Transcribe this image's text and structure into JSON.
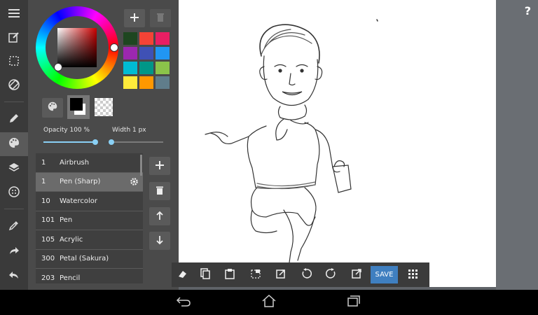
{
  "toolbar": {
    "items": [
      {
        "icon": "menu-icon"
      },
      {
        "icon": "new-canvas-icon"
      },
      {
        "icon": "selection-icon"
      },
      {
        "icon": "transform-icon"
      },
      {
        "icon": "pen-icon"
      },
      {
        "icon": "palette-icon",
        "active": true
      },
      {
        "icon": "layers-icon"
      },
      {
        "icon": "material-icon"
      },
      {
        "icon": "eyedropper-icon"
      },
      {
        "icon": "redo-icon"
      },
      {
        "icon": "undo-icon"
      }
    ]
  },
  "color_panel": {
    "swatches": [
      "#1e4620",
      "#f44336",
      "#e91e63",
      "#9c27b0",
      "#3f51b5",
      "#2196f3",
      "#00bcd4",
      "#009688",
      "#8bc34a",
      "#ffeb3b",
      "#ff9800",
      "#607d8b"
    ],
    "current_color": "#000000",
    "opacity_label": "Opacity 100 %",
    "opacity_value": 100,
    "width_label": "Width 1 px",
    "width_value": 1
  },
  "brushes": [
    {
      "size": "1",
      "name": "Airbrush"
    },
    {
      "size": "1",
      "name": "Pen (Sharp)",
      "selected": true
    },
    {
      "size": "10",
      "name": "Watercolor"
    },
    {
      "size": "101",
      "name": "Pen"
    },
    {
      "size": "105",
      "name": "Acrylic"
    },
    {
      "size": "300",
      "name": "Petal (Sakura)"
    },
    {
      "size": "203",
      "name": "Pencil"
    }
  ],
  "bottom_toolbar": {
    "icons": [
      "eraser-icon",
      "copy-icon",
      "paste-icon",
      "deselect-icon",
      "transfer-icon",
      "rotate-left-icon",
      "rotate-right-icon",
      "export-icon"
    ],
    "save_label": "SAVE",
    "grid_icon": "grid-icon"
  },
  "right": {
    "help_label": "?"
  },
  "navbar": {
    "icons": [
      "back-icon",
      "home-icon",
      "recent-apps-icon"
    ]
  }
}
